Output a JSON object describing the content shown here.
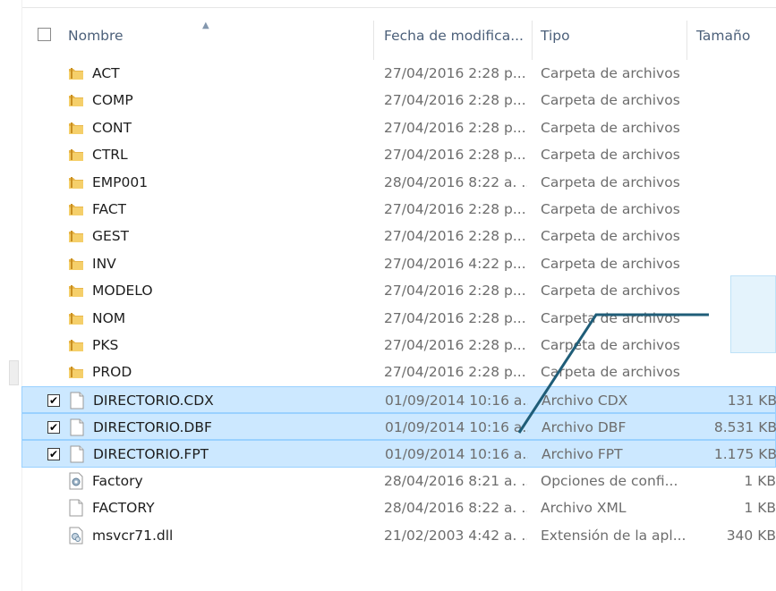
{
  "header": {
    "name": "Nombre",
    "date": "Fecha de modifica...",
    "type": "Tipo",
    "size": "Tamaño"
  },
  "files": [
    {
      "name": "ACT",
      "date": "27/04/2016 2:28 p....",
      "type": "Carpeta de archivos",
      "size": "",
      "icon": "folder-icon",
      "checked": false,
      "selected": false
    },
    {
      "name": "COMP",
      "date": "27/04/2016 2:28 p....",
      "type": "Carpeta de archivos",
      "size": "",
      "icon": "folder-icon",
      "checked": false,
      "selected": false
    },
    {
      "name": "CONT",
      "date": "27/04/2016 2:28 p....",
      "type": "Carpeta de archivos",
      "size": "",
      "icon": "folder-icon",
      "checked": false,
      "selected": false
    },
    {
      "name": "CTRL",
      "date": "27/04/2016 2:28 p....",
      "type": "Carpeta de archivos",
      "size": "",
      "icon": "folder-icon",
      "checked": false,
      "selected": false
    },
    {
      "name": "EMP001",
      "date": "28/04/2016 8:22 a. ...",
      "type": "Carpeta de archivos",
      "size": "",
      "icon": "folder-icon",
      "checked": false,
      "selected": false
    },
    {
      "name": "FACT",
      "date": "27/04/2016 2:28 p....",
      "type": "Carpeta de archivos",
      "size": "",
      "icon": "folder-icon",
      "checked": false,
      "selected": false
    },
    {
      "name": "GEST",
      "date": "27/04/2016 2:28 p....",
      "type": "Carpeta de archivos",
      "size": "",
      "icon": "folder-icon",
      "checked": false,
      "selected": false
    },
    {
      "name": "INV",
      "date": "27/04/2016 4:22 p....",
      "type": "Carpeta de archivos",
      "size": "",
      "icon": "folder-icon",
      "checked": false,
      "selected": false
    },
    {
      "name": "MODELO",
      "date": "27/04/2016 2:28 p....",
      "type": "Carpeta de archivos",
      "size": "",
      "icon": "folder-icon",
      "checked": false,
      "selected": false
    },
    {
      "name": "NOM",
      "date": "27/04/2016 2:28 p....",
      "type": "Carpeta de archivos",
      "size": "",
      "icon": "folder-icon",
      "checked": false,
      "selected": false
    },
    {
      "name": "PKS",
      "date": "27/04/2016 2:28 p....",
      "type": "Carpeta de archivos",
      "size": "",
      "icon": "folder-icon",
      "checked": false,
      "selected": false
    },
    {
      "name": "PROD",
      "date": "27/04/2016 2:28 p....",
      "type": "Carpeta de archivos",
      "size": "",
      "icon": "folder-icon",
      "checked": false,
      "selected": false
    },
    {
      "name": "DIRECTORIO.CDX",
      "date": "01/09/2014 10:16 a....",
      "type": "Archivo CDX",
      "size": "131 KB",
      "icon": "file-icon",
      "checked": true,
      "selected": true
    },
    {
      "name": "DIRECTORIO.DBF",
      "date": "01/09/2014 10:16 a....",
      "type": "Archivo DBF",
      "size": "8.531 KB",
      "icon": "file-icon",
      "checked": true,
      "selected": true
    },
    {
      "name": "DIRECTORIO.FPT",
      "date": "01/09/2014 10:16 a....",
      "type": "Archivo FPT",
      "size": "1.175 KB",
      "icon": "file-icon",
      "checked": true,
      "selected": true
    },
    {
      "name": "Factory",
      "date": "28/04/2016 8:21 a. ...",
      "type": "Opciones de confi...",
      "size": "1 KB",
      "icon": "config-file-icon",
      "checked": false,
      "selected": false
    },
    {
      "name": "FACTORY",
      "date": "28/04/2016 8:22 a. ...",
      "type": "Archivo XML",
      "size": "1 KB",
      "icon": "file-icon",
      "checked": false,
      "selected": false
    },
    {
      "name": "msvcr71.dll",
      "date": "21/02/2003 4:42 a. ...",
      "type": "Extensión de la apl...",
      "size": "340 KB",
      "icon": "dll-file-icon",
      "checked": false,
      "selected": false
    }
  ],
  "colors": {
    "selection_bg": "#cce8ff",
    "selection_border": "#99d1ff",
    "header_text": "#4c607a",
    "annotation_line": "#1f5d78"
  }
}
